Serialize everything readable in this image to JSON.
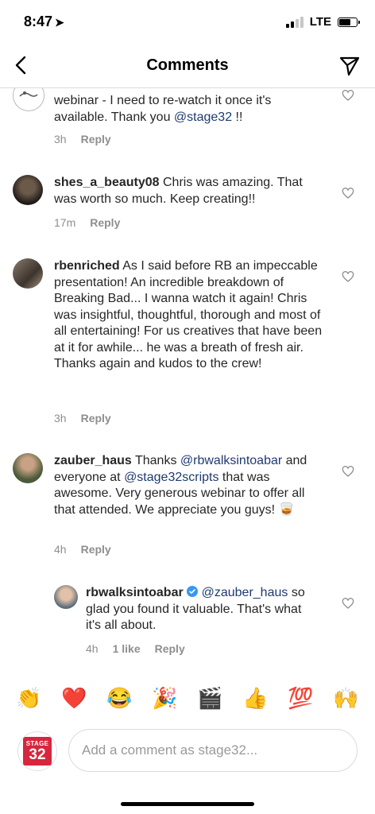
{
  "status_bar": {
    "time": "8:47",
    "carrier": "LTE",
    "battery_level": 0.65,
    "signal_bars": 2
  },
  "header": {
    "title": "Comments",
    "back_icon": "chevron-left-icon",
    "send_icon": "paper-plane-icon"
  },
  "comments": [
    {
      "username": "",
      "text": "webinar - I need to re-watch it once it's available. Thank you ",
      "mention": "@stage32",
      "suffix": " !!",
      "time": "3h",
      "reply": "Reply"
    },
    {
      "username": "shes_a_beauty08",
      "text": "Chris was amazing. That was worth so much. Keep creating!!",
      "time": "17m",
      "reply": "Reply"
    },
    {
      "username": "rbenriched",
      "text": "As I said before RB an impeccable presentation! An incredible breakdown of Breaking Bad... I wanna watch it again! Chris was insightful, thoughtful, thorough and most of all entertaining! For us creatives that have been at it for awhile... he was a breath of fresh air. Thanks again and kudos to the crew!",
      "time": "3h",
      "reply": "Reply"
    },
    {
      "username": "zauber_haus",
      "text_a": "Thanks ",
      "mention_a": "@rbwalksintoabar",
      "text_b": " and everyone at ",
      "mention_b": "@stage32scripts",
      "text_c": " that was awesome. Very generous webinar to offer all that attended. We appreciate you guys! ",
      "emoji": "🥃",
      "time": "4h",
      "reply": "Reply"
    },
    {
      "username": "rbwalksintoabar",
      "verified": true,
      "mention": "@zauber_haus",
      "text": " so glad you found it valuable. That's what it's all about.",
      "time": "4h",
      "likes": "1 like",
      "reply": "Reply"
    }
  ],
  "emoji_bar": [
    "👏",
    "❤️",
    "😂",
    "🎉",
    "🎬",
    "👍",
    "💯",
    "🙌"
  ],
  "composer": {
    "placeholder": "Add a comment as stage32...",
    "logo_top": "STAGE",
    "logo_num": "32"
  }
}
